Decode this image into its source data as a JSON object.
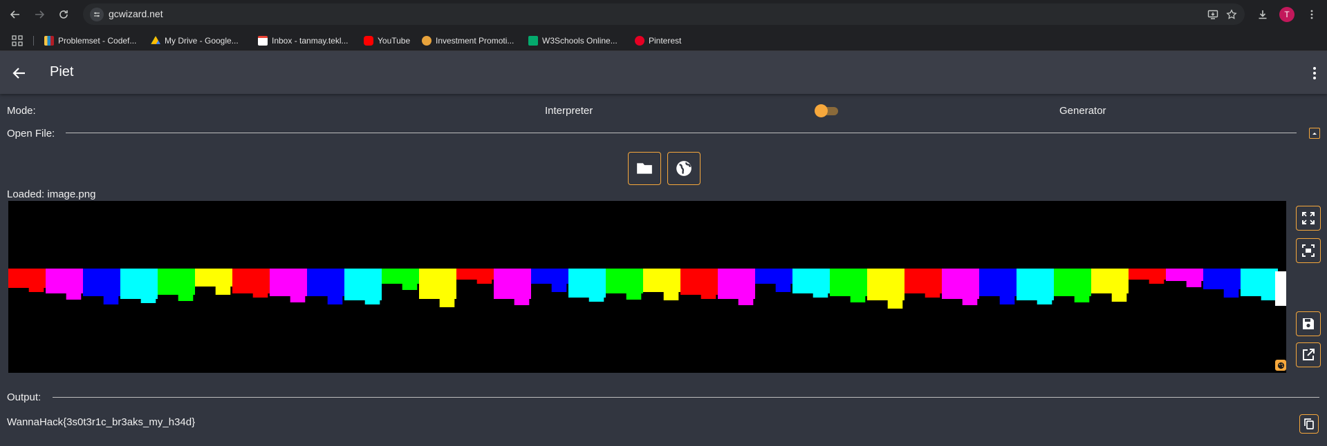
{
  "browser": {
    "url": "gcwizard.net",
    "profile_initial": "T",
    "bookmarks": [
      {
        "label": "Problemset - Codef...",
        "color": "#1f8acb"
      },
      {
        "label": "My Drive - Google...",
        "color": "#34a853"
      },
      {
        "label": "Inbox - tanmay.tekl...",
        "color": "#ea4335"
      },
      {
        "label": "YouTube",
        "color": "#ff0000"
      },
      {
        "label": "Investment Promoti...",
        "color": "#e8a33c"
      },
      {
        "label": "W3Schools Online...",
        "color": "#04aa6d"
      },
      {
        "label": "Pinterest",
        "color": "#e60023"
      }
    ]
  },
  "app": {
    "title": "Piet",
    "mode_label": "Mode:",
    "mode_left": "Interpreter",
    "mode_right": "Generator",
    "open_file_label": "Open File:",
    "loaded_text": "Loaded: image.png",
    "output_label": "Output:",
    "output_value": "WannaHack{3s0t3r1c_br3aks_my_h34d}",
    "accent": "#f7a83c"
  },
  "piet_colors": [
    "#ff0000",
    "#ff00ff",
    "#0000ff",
    "#00ffff",
    "#00ff00",
    "#ffff00"
  ]
}
